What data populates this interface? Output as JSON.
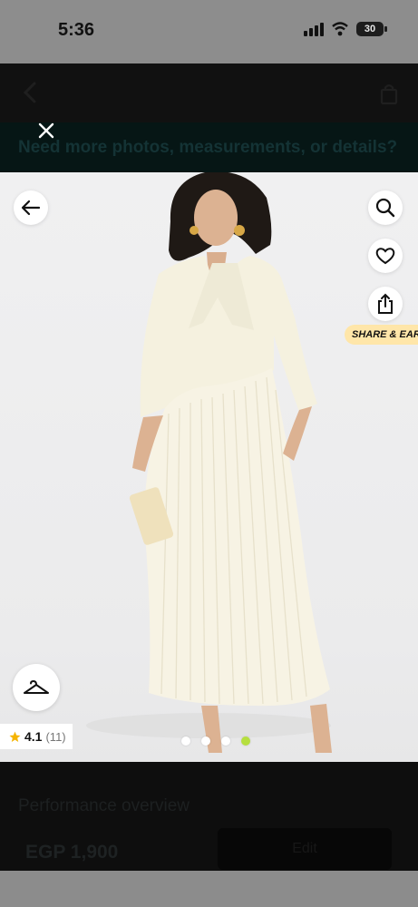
{
  "status_bar": {
    "time": "5:36",
    "battery": "30",
    "icons": [
      "signal-icon",
      "wifi-icon",
      "battery-icon"
    ]
  },
  "header": {
    "icons": [
      "chevron-left-icon",
      "shopping-bag-icon"
    ]
  },
  "promo_banner": {
    "text": "Need more photos, measurements, or details?"
  },
  "overlay": {
    "close_icon": "close-icon"
  },
  "product_gallery": {
    "share_earn_label": "SHARE & EARN",
    "rating": {
      "value": "4.1",
      "count": "(11)"
    },
    "dots": 4,
    "active_dot_index": 3,
    "icons": [
      "back-arrow-icon",
      "search-icon",
      "heart-icon",
      "share-icon",
      "hanger-icon",
      "star-icon"
    ],
    "colors": {
      "active_dot": "#b6df3f",
      "share_earn_bg": "#ffe6a9",
      "star": "#f5b400"
    }
  },
  "bottom_sheet": {
    "title": "Performance overview",
    "price": "EGP 1,900",
    "edit_button": "Edit"
  }
}
